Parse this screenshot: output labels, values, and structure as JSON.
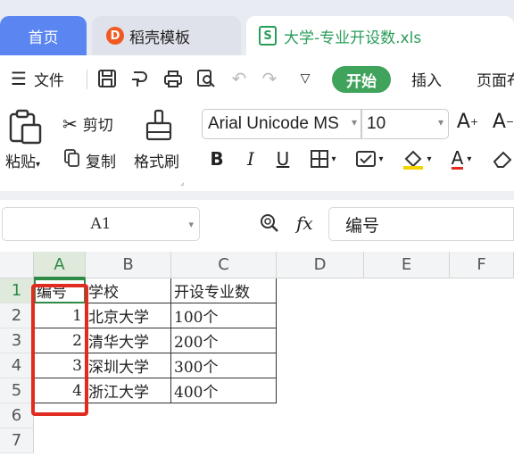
{
  "tabs": {
    "home": "首页",
    "docer": "稻壳模板",
    "file": "大学-专业开设数.xls"
  },
  "menu": {
    "file_label": "文件",
    "start": "开始",
    "insert": "插入",
    "page": "页面布"
  },
  "ribbon": {
    "cut": "剪切",
    "copy": "复制",
    "paste": "粘贴",
    "format_painter": "格式刷",
    "font_name": "Arial Unicode MS",
    "font_size": "10"
  },
  "formula_bar": {
    "cell_ref": "A1",
    "fx": "fx",
    "content": "编号"
  },
  "sheet": {
    "columns": [
      "A",
      "B",
      "C",
      "D",
      "E",
      "F"
    ],
    "rows": [
      "1",
      "2",
      "3",
      "4",
      "5",
      "6",
      "7"
    ],
    "header": [
      "编号",
      "学校",
      "开设专业数"
    ],
    "data": [
      [
        "1",
        "北京大学",
        "100个"
      ],
      [
        "2",
        "清华大学",
        "200个"
      ],
      [
        "3",
        "深圳大学",
        "300个"
      ],
      [
        "4",
        "浙江大学",
        "400个"
      ]
    ]
  },
  "colors": {
    "accent_green": "#3fa35c",
    "home_tab_blue": "#5b86f2",
    "highlight_red": "#e22b20"
  }
}
